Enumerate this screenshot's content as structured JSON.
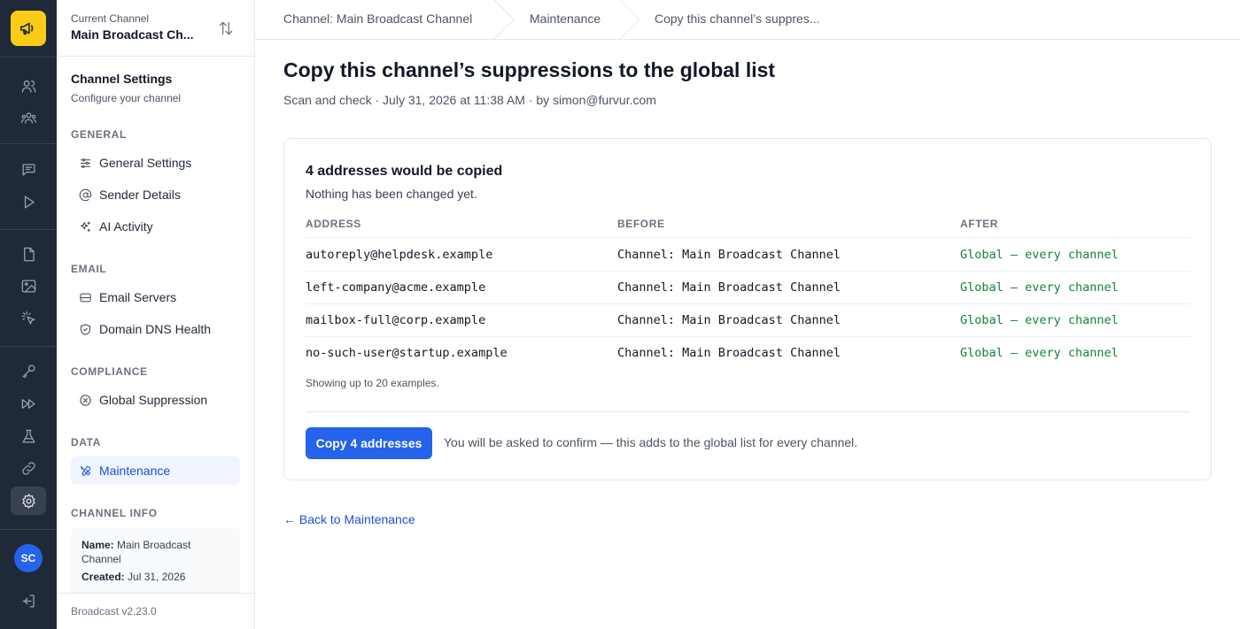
{
  "rail": {
    "logo_icon": "megaphone-icon",
    "avatar_initials": "SC",
    "active_item": "settings",
    "accent_color": "#facc15"
  },
  "channel_switcher": {
    "caption": "Current Channel",
    "name": "Main Broadcast Ch..."
  },
  "sidebar": {
    "title": "Channel Settings",
    "subtitle": "Configure your channel",
    "sections": {
      "general": "GENERAL",
      "email": "EMAIL",
      "compliance": "COMPLIANCE",
      "data": "DATA",
      "channel_info": "CHANNEL INFO"
    },
    "items": {
      "general_settings": "General Settings",
      "sender_details": "Sender Details",
      "ai_activity": "AI Activity",
      "email_servers": "Email Servers",
      "domain_dns_health": "Domain DNS Health",
      "global_suppression": "Global Suppression",
      "maintenance": "Maintenance"
    },
    "channel_info": {
      "name_label": "Name:",
      "name_value": "Main Broadcast Channel",
      "created_label": "Created:",
      "created_value": "Jul 31, 2026"
    },
    "version": "Broadcast v2.23.0"
  },
  "breadcrumb": {
    "items": [
      "Channel: Main Broadcast Channel",
      "Maintenance",
      "Copy this channel’s suppres..."
    ]
  },
  "page": {
    "title": "Copy this channel’s suppressions to the global list",
    "subtitle": "Scan and check · July 31, 2026 at 11:38 AM · by simon@furvur.com"
  },
  "result_card": {
    "heading": "4 addresses would be copied",
    "subheading": "Nothing has been changed yet.",
    "columns": [
      "ADDRESS",
      "BEFORE",
      "AFTER"
    ],
    "rows": [
      {
        "address": "autoreply@helpdesk.example",
        "before": "Channel: Main Broadcast Channel",
        "after": "Global — every channel"
      },
      {
        "address": "left-company@acme.example",
        "before": "Channel: Main Broadcast Channel",
        "after": "Global — every channel"
      },
      {
        "address": "mailbox-full@corp.example",
        "before": "Channel: Main Broadcast Channel",
        "after": "Global — every channel"
      },
      {
        "address": "no-such-user@startup.example",
        "before": "Channel: Main Broadcast Channel",
        "after": "Global — every channel"
      }
    ],
    "note": "Showing up to 20 examples.",
    "button_label": "Copy 4 addresses",
    "button_note": "You will be asked to confirm — this adds to the global list for every channel.",
    "primary_color": "#2563eb",
    "after_color": "#15803d"
  },
  "back_link": "← Back to Maintenance"
}
